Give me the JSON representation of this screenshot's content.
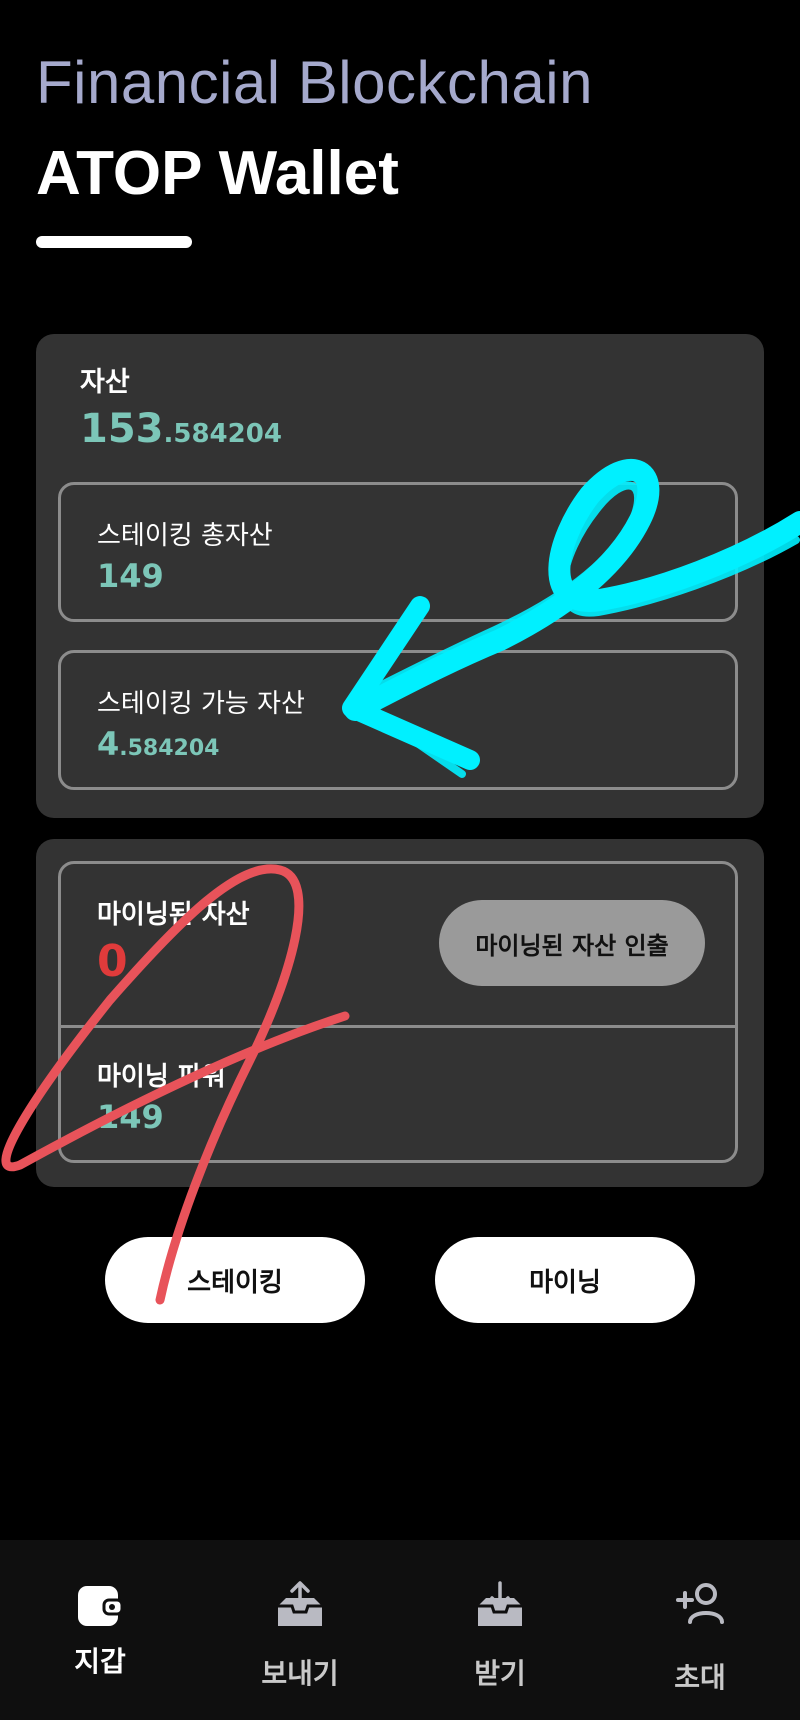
{
  "header": {
    "subtitle": "Financial Blockchain",
    "title": "ATOP Wallet"
  },
  "assets": {
    "label": "자산",
    "value_int": "153",
    "value_dec": ".584204",
    "staking_total": {
      "label": "스테이킹 총자산",
      "value": "149"
    },
    "staking_available": {
      "label": "스테이킹 가능 자산",
      "value_int": "4",
      "value_dec": ".584204"
    }
  },
  "mining": {
    "mined_label": "마이닝된 자산",
    "mined_value": "0",
    "withdraw_button": "마이닝된 자산 인출",
    "power_label": "마이닝 파워",
    "power_value": "149"
  },
  "actions": {
    "staking": "스테이킹",
    "mining": "마이닝"
  },
  "tabs": [
    {
      "label": "지갑",
      "icon": "wallet-icon",
      "active": true
    },
    {
      "label": "보내기",
      "icon": "send-icon"
    },
    {
      "label": "받기",
      "icon": "receive-icon"
    },
    {
      "label": "초대",
      "icon": "invite-icon"
    }
  ],
  "colors": {
    "background": "#000000",
    "card": "#333333",
    "accent_teal": "#7cc6b8",
    "alert_red": "#e03b3b",
    "header_sub": "#a5a9cc",
    "annotation_cyan": "#00f0ff",
    "annotation_red": "#e8535a"
  }
}
